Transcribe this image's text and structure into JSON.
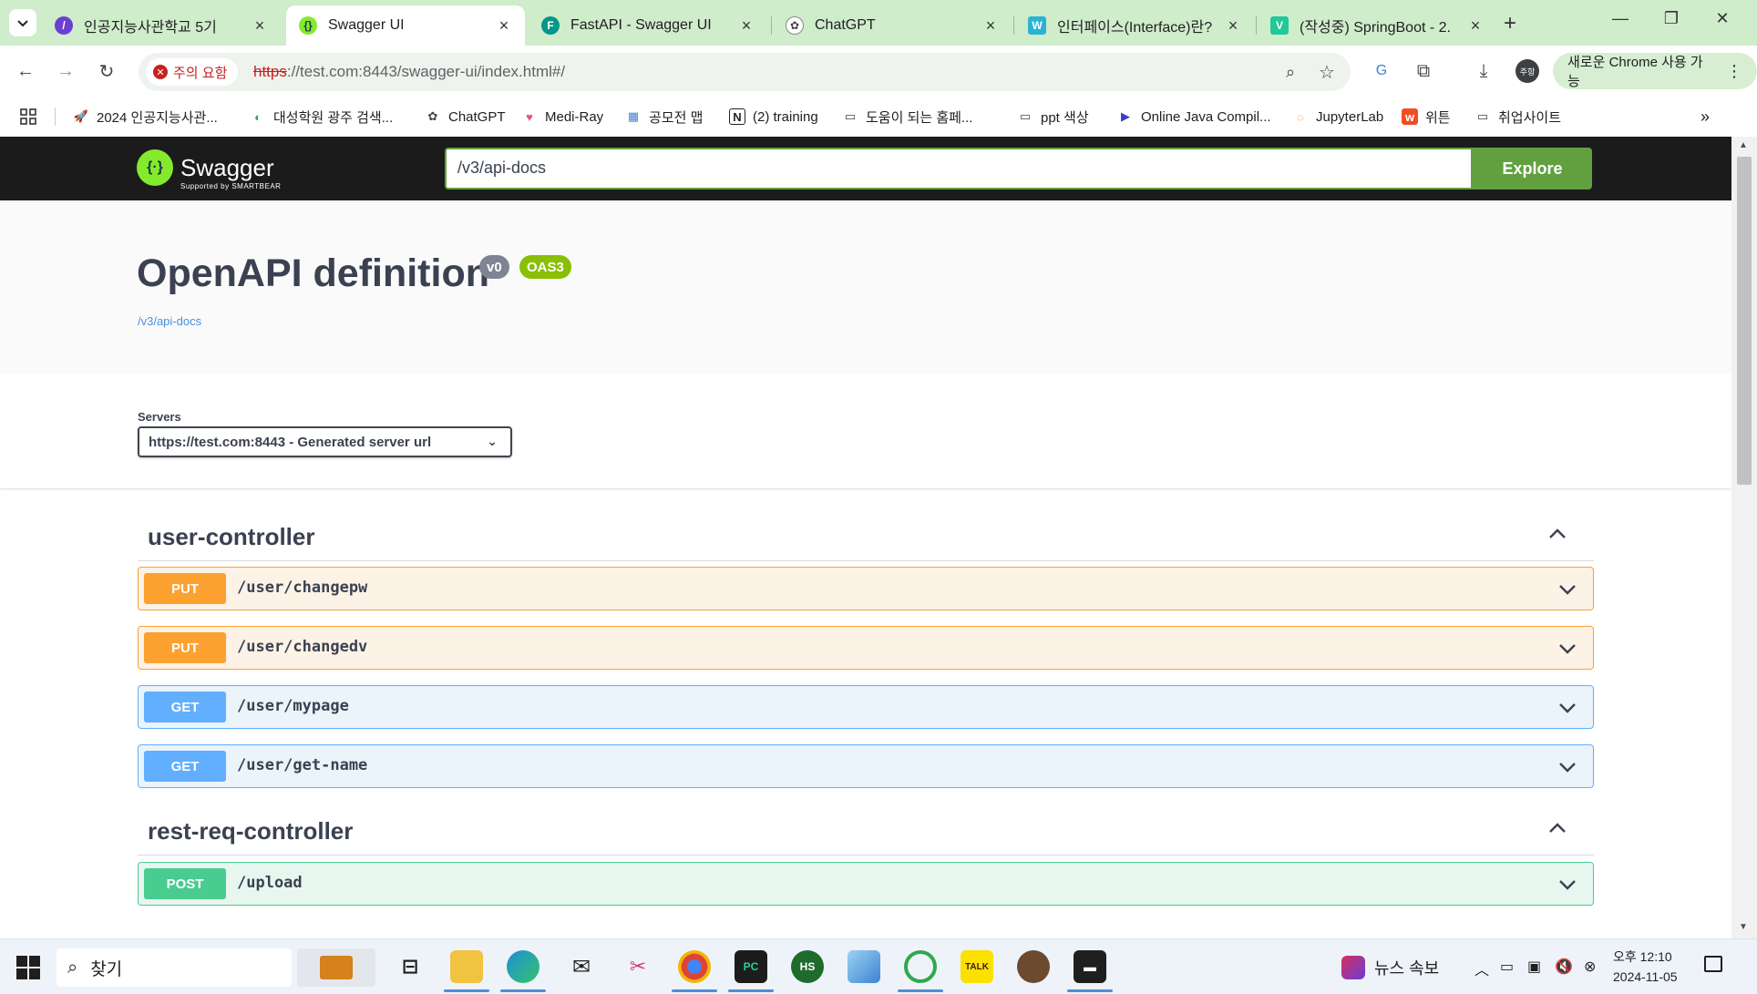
{
  "tabs": [
    {
      "label": "인공지능사관학교 5기",
      "fav_color": "#6b3fd4",
      "fav_text": "/",
      "active": false
    },
    {
      "label": "Swagger UI",
      "fav_color": "#85ea2d",
      "fav_text": "{}",
      "active": true
    },
    {
      "label": "FastAPI - Swagger UI",
      "fav_color": "#049688",
      "fav_text": "F",
      "active": false
    },
    {
      "label": "ChatGPT",
      "fav_color": "#444444",
      "fav_text": "✿",
      "active": false
    },
    {
      "label": "인터페이스(Interface)란?",
      "fav_color": "#2ab3d6",
      "fav_text": "W",
      "active": false
    },
    {
      "label": "(작성중) SpringBoot - 2.",
      "fav_color": "#20c997",
      "fav_text": "V",
      "active": false
    }
  ],
  "toolbar": {
    "security_warning": "주의 요함",
    "url_scheme": "https",
    "url_rest": "://test.com:8443/swagger-ui/index.html#/",
    "chrome_new": "새로운 Chrome 사용 가능",
    "profile_label": "주항"
  },
  "bookmarks": [
    {
      "label": "2024 인공지능사관...",
      "icon": "rocket-icon",
      "color": "#e8453c",
      "glyph": "🚀"
    },
    {
      "label": "대성학원 광주 검색...",
      "icon": "leaf-icon",
      "color": "#2fa84f",
      "glyph": "◐"
    },
    {
      "label": "ChatGPT",
      "icon": "chatgpt-icon",
      "color": "#444444",
      "glyph": "✿"
    },
    {
      "label": "Medi-Ray",
      "icon": "lungs-icon",
      "color": "#e05a7a",
      "glyph": "♥"
    },
    {
      "label": "공모전 맵",
      "icon": "map-icon",
      "color": "#3c82d6",
      "glyph": "▦"
    },
    {
      "label": "(2) training",
      "icon": "notion-icon",
      "color": "#222222",
      "glyph": "N"
    },
    {
      "label": "도움이 되는 홈페...",
      "icon": "folder-icon",
      "color": "#444444",
      "glyph": "▭"
    },
    {
      "label": "ppt 색상",
      "icon": "folder-icon",
      "color": "#444444",
      "glyph": "▭"
    },
    {
      "label": "Online Java Compil...",
      "icon": "compiler-icon",
      "color": "#3b3bd6",
      "glyph": "▶"
    },
    {
      "label": "JupyterLab",
      "icon": "jupyter-icon",
      "color": "#f37726",
      "glyph": "◌"
    },
    {
      "label": "위튼",
      "icon": "wanted-icon",
      "color": "#f04e23",
      "glyph": "w"
    },
    {
      "label": "취업사이트",
      "icon": "folder-icon",
      "color": "#444444",
      "glyph": "▭"
    }
  ],
  "swagger": {
    "logo_text": "Swagger",
    "logo_sub": "Supported by SMARTBEAR",
    "spec_url": "/v3/api-docs",
    "explore_label": "Explore",
    "title": "OpenAPI definition",
    "version_badge": "v0",
    "oas_badge": "OAS3",
    "info_link": "/v3/api-docs",
    "servers_label": "Servers",
    "server_selected": "https://test.com:8443 - Generated server url"
  },
  "tags": [
    {
      "name": "user-controller",
      "operations": [
        {
          "method": "PUT",
          "path": "/user/changepw"
        },
        {
          "method": "PUT",
          "path": "/user/changedv"
        },
        {
          "method": "GET",
          "path": "/user/mypage"
        },
        {
          "method": "GET",
          "path": "/user/get-name"
        }
      ]
    },
    {
      "name": "rest-req-controller",
      "operations": [
        {
          "method": "POST",
          "path": "/upload"
        }
      ]
    }
  ],
  "taskbar": {
    "search_placeholder": "찾기",
    "news_label": "뉴스 속보",
    "ime_label": "\u001e",
    "clock_time": "오후 12:10",
    "clock_date": "2024-11-05"
  }
}
